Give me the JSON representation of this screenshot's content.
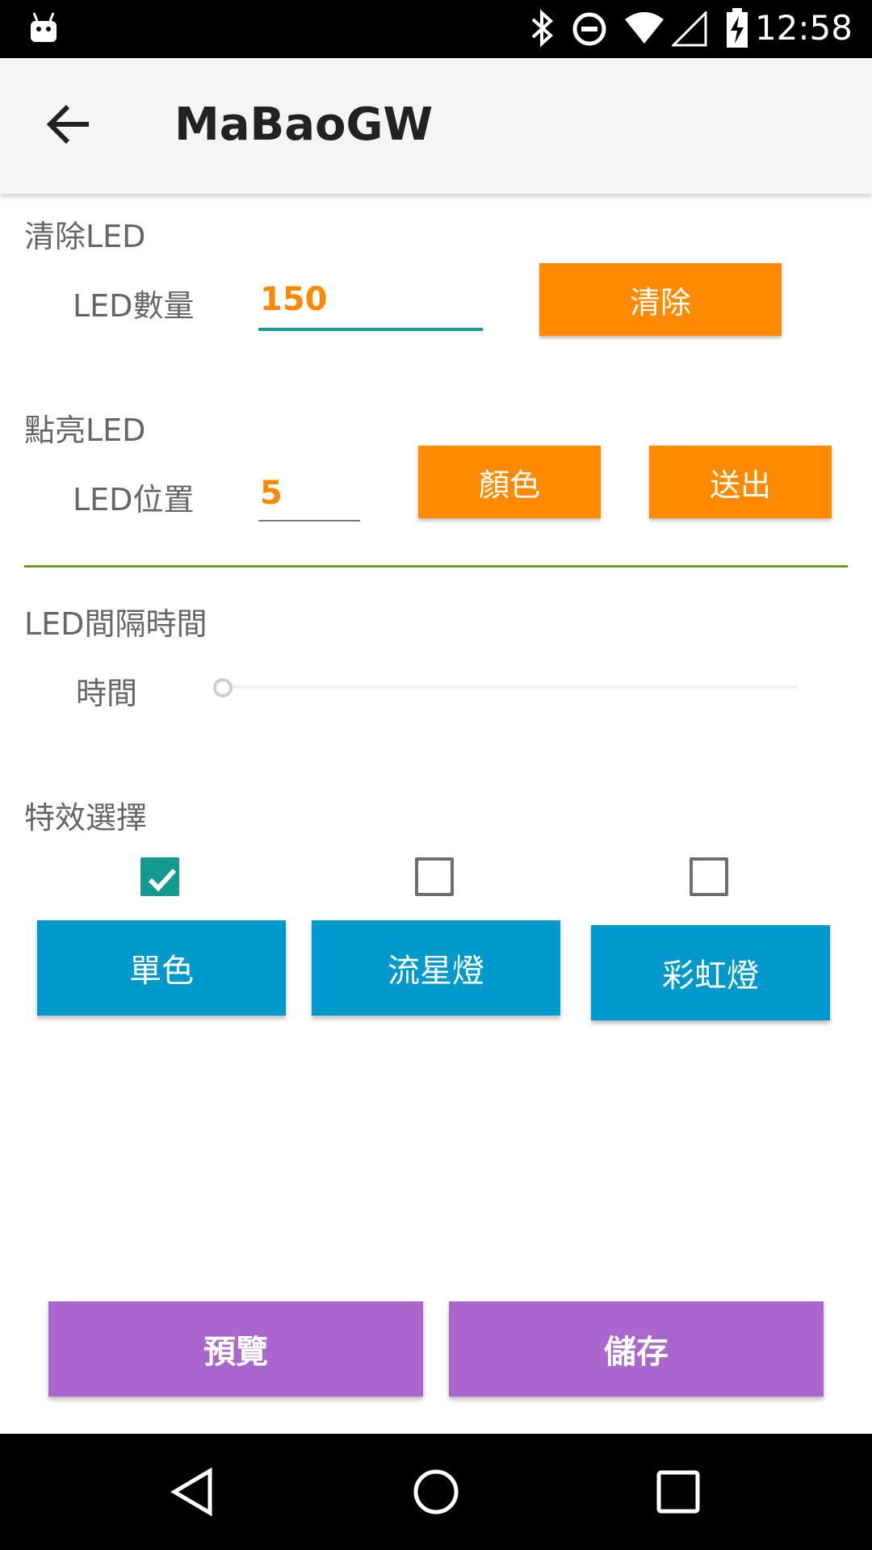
{
  "status_bar": {
    "time": "12:58",
    "icons": [
      "android-icon",
      "bluetooth-icon",
      "do-not-disturb-icon",
      "wifi-icon",
      "signal-icon",
      "battery-charging-icon"
    ]
  },
  "app_bar": {
    "title": "MaBaoGW",
    "back_icon": "arrow-back-icon"
  },
  "clear_section": {
    "label": "清除LED",
    "count_label": "LED數量",
    "count_value": "150",
    "clear_button": "清除"
  },
  "light_section": {
    "label": "點亮LED",
    "position_label": "LED位置",
    "position_value": "5",
    "color_button": "顏色",
    "send_button": "送出"
  },
  "interval_section": {
    "label": "LED間隔時間",
    "time_label": "時間",
    "slider_value": 0
  },
  "effects_section": {
    "label": "特效選擇",
    "options": [
      {
        "label": "單色",
        "checked": true
      },
      {
        "label": "流星燈",
        "checked": false
      },
      {
        "label": "彩虹燈",
        "checked": false
      }
    ]
  },
  "footer": {
    "preview_button": "預覽",
    "save_button": "儲存"
  },
  "colors": {
    "orange": "#ff8a00",
    "blue": "#0099cc",
    "purple": "#aa66cc",
    "teal": "#149a8f",
    "divider_green": "#6aa121"
  },
  "nav_bar": {
    "icons": [
      "nav-back-icon",
      "nav-home-icon",
      "nav-recents-icon"
    ]
  }
}
